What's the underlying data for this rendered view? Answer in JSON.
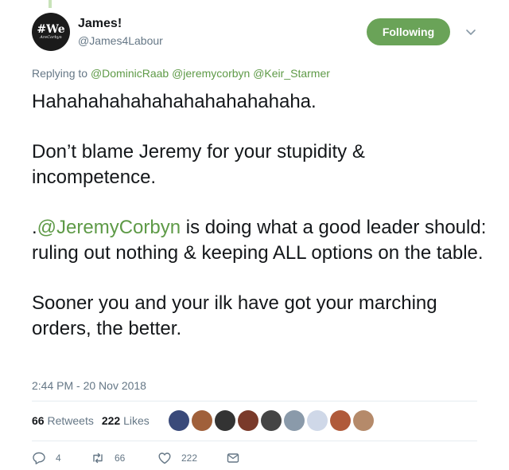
{
  "author": {
    "name": "James!",
    "handle": "@James4Labour",
    "avatar_text": "#We",
    "avatar_subtext": "AreCorbyn"
  },
  "follow_button": {
    "label": "Following"
  },
  "reply": {
    "prefix": "Replying to",
    "mentions": [
      "@DominicRaab",
      "@jeremycorbyn",
      "@Keir_Starmer"
    ]
  },
  "tweet": {
    "p1": "Hahahahahahahahahahahahaha.",
    "p2": "Don’t blame Jeremy for your stupidity & incompetence.",
    "p3_prefix": ".",
    "p3_mention": "@JeremyCorbyn",
    "p3_rest": " is doing what a good leader should: ruling out nothing & keeping ALL options on the table.",
    "p4": "Sooner you and your ilk have got your marching orders, the better."
  },
  "timestamp": "2:44 PM - 20 Nov 2018",
  "stats": {
    "retweets_count": "66",
    "retweets_label": "Retweets",
    "likes_count": "222",
    "likes_label": "Likes"
  },
  "actions": {
    "replies": "4",
    "retweets": "66",
    "likes": "222"
  },
  "colors": {
    "accent": "#6aa358",
    "mention": "#5e9a47",
    "muted": "#657786"
  },
  "liker_avatar_colors": [
    "#3a4a7a",
    "#a0603a",
    "#333333",
    "#7a3a2a",
    "#444444",
    "#8a9aaa",
    "#cfd8e8",
    "#b05a3a",
    "#b58a6a"
  ]
}
